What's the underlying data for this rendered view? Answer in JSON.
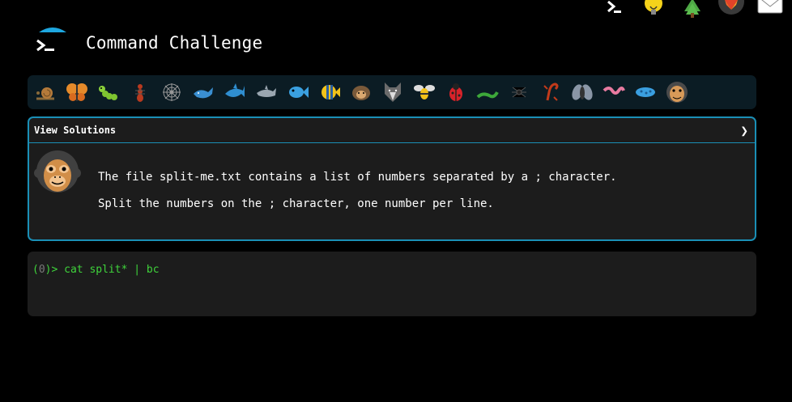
{
  "header": {
    "title": "Command Challenge",
    "top_icons": [
      "terminal-icon",
      "lightbulb-icon",
      "tree-icon",
      "gitlab-icon",
      "mail-icon"
    ]
  },
  "levels": [
    {
      "name": "snail-icon"
    },
    {
      "name": "butterfly-icon"
    },
    {
      "name": "caterpillar-icon"
    },
    {
      "name": "ant-icon"
    },
    {
      "name": "spider-web-icon"
    },
    {
      "name": "whale-icon"
    },
    {
      "name": "shark-icon"
    },
    {
      "name": "dolphin-icon"
    },
    {
      "name": "fish-icon"
    },
    {
      "name": "tropical-fish-icon"
    },
    {
      "name": "hedgehog-icon"
    },
    {
      "name": "wolf-icon"
    },
    {
      "name": "bee-icon"
    },
    {
      "name": "ladybug-icon"
    },
    {
      "name": "lizard-icon"
    },
    {
      "name": "spider-icon"
    },
    {
      "name": "scorpion-icon"
    },
    {
      "name": "fly-icon"
    },
    {
      "name": "worm-icon"
    },
    {
      "name": "microbe-icon"
    },
    {
      "name": "monkey-icon",
      "current": true
    }
  ],
  "panel": {
    "header_label": "View Solutions",
    "chevron": "❯",
    "line1": "The file split-me.txt contains a list of numbers separated by a ; character.",
    "line2": "Split the numbers on the ; character, one number per line."
  },
  "terminal": {
    "prompt_open": "(",
    "exit_code": "0",
    "prompt_close": ")> ",
    "command": "cat split* | bc"
  },
  "colors": {
    "background": "#000000",
    "panel_border": "#1a8fb6",
    "level_bar": "#0b1c24",
    "prompt_green": "#3fd43b"
  }
}
